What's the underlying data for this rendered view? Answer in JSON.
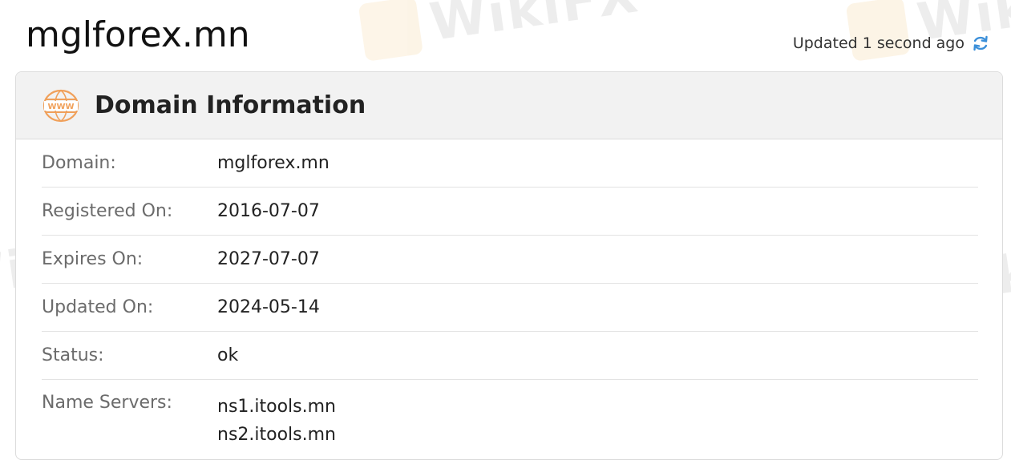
{
  "page": {
    "title": "mglforex.mn",
    "updated_text": "Updated 1 second ago"
  },
  "card": {
    "title": "Domain Information",
    "icon": "www-icon"
  },
  "rows": [
    {
      "label": "Domain:",
      "value": "mglforex.mn"
    },
    {
      "label": "Registered On:",
      "value": "2016-07-07"
    },
    {
      "label": "Expires On:",
      "value": "2027-07-07"
    },
    {
      "label": "Updated On:",
      "value": "2024-05-14"
    },
    {
      "label": "Status:",
      "value": "ok"
    }
  ],
  "name_servers": {
    "label": "Name Servers:",
    "values": [
      "ns1.itools.mn",
      "ns2.itools.mn"
    ]
  },
  "watermark": {
    "text": "WikiFX"
  },
  "colors": {
    "accent_orange": "#f0a05a",
    "refresh_blue": "#3b8fd9"
  }
}
